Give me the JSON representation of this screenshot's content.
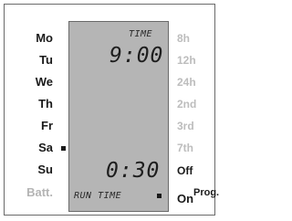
{
  "days": [
    "Mo",
    "Tu",
    "We",
    "Th",
    "Fr",
    "Sa",
    "Su"
  ],
  "battery_label": "Batt.",
  "lcd": {
    "top_label": "TIME",
    "clock_time": "9:00",
    "run_time": "0:30",
    "bottom_label": "RUN TIME"
  },
  "run_interval_options": [
    "8h",
    "12h",
    "24h",
    "2nd",
    "3rd",
    "7th"
  ],
  "off_label": "Off",
  "on_label": "On",
  "prog_label": "Prog."
}
